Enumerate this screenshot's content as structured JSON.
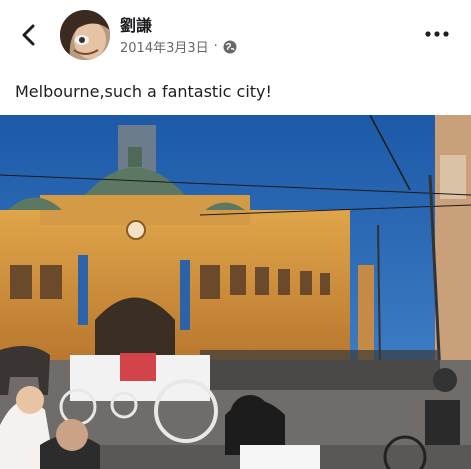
{
  "post": {
    "author_name": "劉謙",
    "date": "2014年3月3日",
    "separator": "·",
    "privacy_icon": "globe-icon",
    "caption": "Melbourne,such a fantastic city!"
  },
  "icons": {
    "back": "chevron-left-icon",
    "more": "more-horizontal-icon"
  },
  "colors": {
    "text": "#1c1e21",
    "meta": "#65676b",
    "sky": "#1f5fae"
  }
}
